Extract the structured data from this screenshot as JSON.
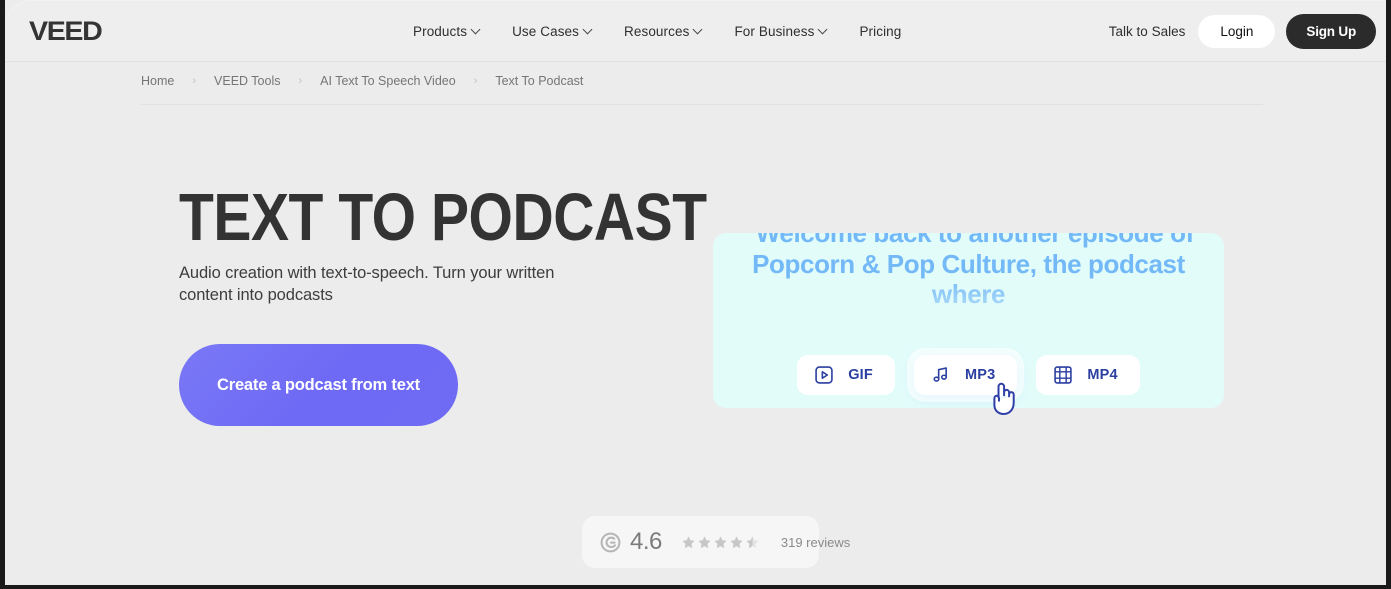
{
  "brand": {
    "logo_text": "VEED"
  },
  "nav": {
    "links": [
      {
        "label": "Products",
        "has_caret": true
      },
      {
        "label": "Use Cases",
        "has_caret": true
      },
      {
        "label": "Resources",
        "has_caret": true
      },
      {
        "label": "For Business",
        "has_caret": true
      },
      {
        "label": "Pricing",
        "has_caret": false
      }
    ],
    "talk_to_sales": "Talk to Sales",
    "login": "Login",
    "signup": "Sign Up",
    "caret_icon": "chevron-down-icon"
  },
  "breadcrumb": {
    "separator": "›",
    "items": [
      {
        "label": "Home"
      },
      {
        "label": "VEED Tools"
      },
      {
        "label": "AI Text To Speech Video"
      },
      {
        "label": "Text To Podcast"
      }
    ]
  },
  "hero": {
    "heading": "TEXT TO PODCAST",
    "subheading": "Audio creation with text-to-speech. Turn your written content into podcasts",
    "cta_label": "Create a podcast from text"
  },
  "preview": {
    "transcript": "“Welcome back to another episode of Popcorn & Pop Culture, the podcast where",
    "formats": [
      {
        "label": "GIF",
        "icon": "play-in-square-icon",
        "hovered": false
      },
      {
        "label": "MP3",
        "icon": "music-note-icon",
        "hovered": true
      },
      {
        "label": "MP4",
        "icon": "film-strip-icon",
        "hovered": false
      }
    ],
    "cursor_icon": "pointing-hand-cursor"
  },
  "rating": {
    "badge_icon": "g2-logo-icon",
    "score": "4.6",
    "stars_filled": 4,
    "stars_half": 1,
    "stars_total": 5,
    "review_count": "319 reviews"
  },
  "colors": {
    "page_background": "#ececec",
    "navbar_background": "#eeeeee",
    "cta_purple": "#6f6af5",
    "signup_dark": "#2b2b2b",
    "card_mint": "#e2fcfa",
    "transcript_blue": "#73b8f7",
    "format_text_blue": "#2a3fa0",
    "heading_dark": "#333333"
  }
}
